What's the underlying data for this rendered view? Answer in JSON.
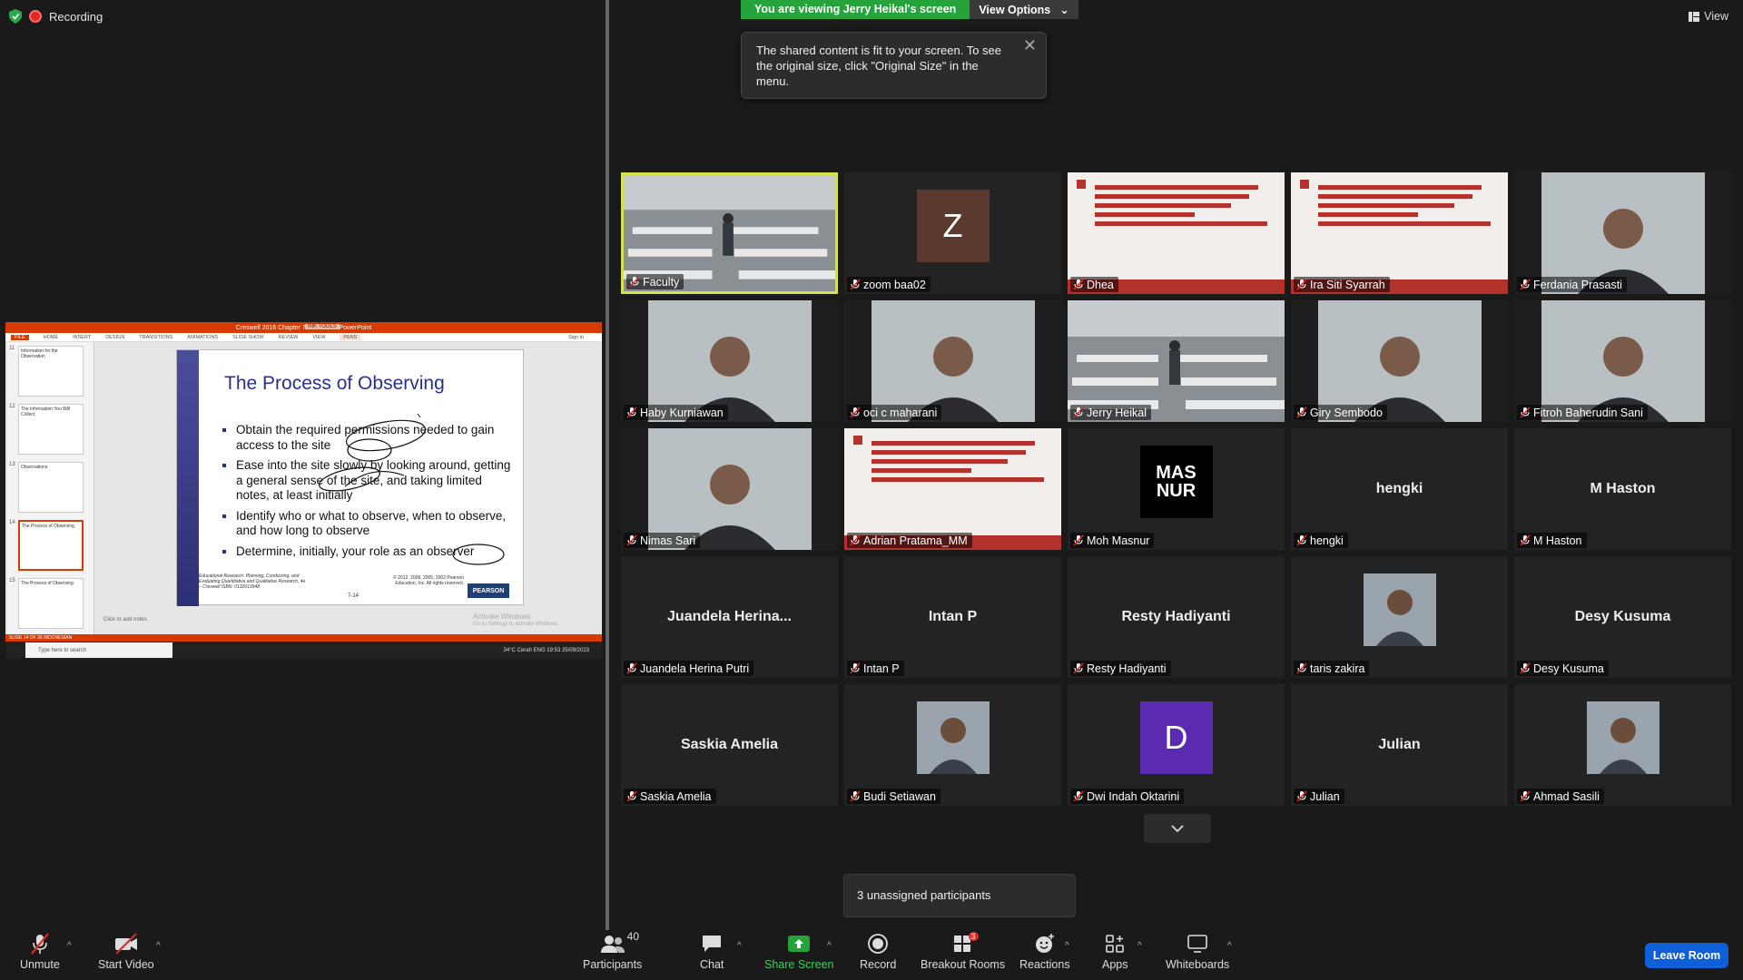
{
  "top": {
    "recording_label": "Recording",
    "banner_text": "You are viewing Jerry Heikal's screen",
    "view_options_label": "View Options",
    "view_label": "View",
    "tip_text": "The shared content is fit to your screen. To see the original size, click \"Original Size\" in the menu."
  },
  "share": {
    "window_title": "Creswell 2016 Chapter 7 - Microsoft PowerPoint",
    "tools_tab": "INK TOOLS",
    "ribbon_tabs": [
      "FILE",
      "HOME",
      "INSERT",
      "DESIGN",
      "TRANSITIONS",
      "ANIMATIONS",
      "SLIDE SHOW",
      "REVIEW",
      "VIEW",
      "PENS"
    ],
    "sign_in": "Sign in",
    "thumbnails": [
      {
        "num": "11",
        "title": "Information for the Observation"
      },
      {
        "num": "12",
        "title": "The Information You Will Collect"
      },
      {
        "num": "13",
        "title": "Observations"
      },
      {
        "num": "14",
        "title": "The Process of Observing"
      },
      {
        "num": "15",
        "title": "The Process of Observing"
      }
    ],
    "slide_title": "The Process of Observing",
    "bullets": [
      "Obtain the required permissions needed to gain access to the site",
      "Ease into the site slowly by looking around, getting a general sense of the site, and taking limited notes, at least initially",
      "Identify who or what to observe, when to observe, and how long to observe",
      "Determine, initially, your role as an observer"
    ],
    "footer_text": "Educational Research: Planning, Conducting, and Evaluating Quantitative and Qualitative Research, 4e – Creswell ISBN: 0132613948",
    "page_number": "7-14",
    "copyright": "© 2012, 2008, 2005, 2002 Pearson Education, Inc. All rights reserved.",
    "pearson_logo": "PEARSON",
    "notes_placeholder": "Click to add notes",
    "activate_title": "Activate Windows",
    "activate_sub": "Go to Settings to activate Windows.",
    "status_text": "SLIDE 14 OF 26    INDONESIAN",
    "taskbar_search": "Type here to search",
    "taskbar_tray": "34°C Cerah   ENG  19:53  25/09/2023"
  },
  "participants": [
    {
      "name": "Faculty",
      "type": "video-room",
      "active": true
    },
    {
      "name": "zoom baa02",
      "type": "avatar",
      "letter": "Z",
      "color": "#5a3a2e"
    },
    {
      "name": "Dhea",
      "type": "video-banner"
    },
    {
      "name": "Ira Siti Syarrah",
      "type": "video-banner-mirror"
    },
    {
      "name": "Ferdania Prasasti",
      "type": "video-person"
    },
    {
      "name": "Haby Kurniawan",
      "type": "video-person"
    },
    {
      "name": "oci c maharani",
      "type": "video-person"
    },
    {
      "name": "Jerry Heikal",
      "type": "video-room"
    },
    {
      "name": "Giry Sembodo",
      "type": "video-person"
    },
    {
      "name": "Fitroh Baherudin Sani",
      "type": "video-person"
    },
    {
      "name": "Nimas Sari",
      "type": "video-person"
    },
    {
      "name": "Adrian Pratama_MM",
      "type": "video-banner"
    },
    {
      "name": "Moh Masnur",
      "type": "logo",
      "logo_text": "MAS NUR"
    },
    {
      "name": "hengki",
      "type": "name",
      "center": "hengki"
    },
    {
      "name": "M Haston",
      "type": "name",
      "center": "M Haston"
    },
    {
      "name": "Juandela Herina Putri",
      "type": "name",
      "center": "Juandela  Herina..."
    },
    {
      "name": "Intan P",
      "type": "name",
      "center": "Intan P"
    },
    {
      "name": "Resty Hadiyanti",
      "type": "name",
      "center": "Resty Hadiyanti"
    },
    {
      "name": "taris zakira",
      "type": "photo"
    },
    {
      "name": "Desy Kusuma",
      "type": "name",
      "center": "Desy Kusuma"
    },
    {
      "name": "Saskia Amelia",
      "type": "name",
      "center": "Saskia Amelia"
    },
    {
      "name": "Budi Setiawan",
      "type": "photo"
    },
    {
      "name": "Dwi Indah Oktarini",
      "type": "avatar",
      "letter": "D",
      "color": "#5a2bb0"
    },
    {
      "name": "Julian",
      "type": "name",
      "center": "Julian"
    },
    {
      "name": "Ahmad Sasili",
      "type": "photo"
    }
  ],
  "unassigned_text": "3 unassigned participants",
  "toolbar": {
    "unmute": "Unmute",
    "start_video": "Start Video",
    "participants": "Participants",
    "participants_count": "40",
    "chat": "Chat",
    "share_screen": "Share Screen",
    "record": "Record",
    "breakout_rooms": "Breakout Rooms",
    "breakout_badge": "3",
    "reactions": "Reactions",
    "apps": "Apps",
    "whiteboards": "Whiteboards",
    "leave_room": "Leave Room"
  },
  "colors": {
    "share_green": "#26a33a",
    "leave_blue": "#0e5fd8",
    "active_border": "#d6e24a",
    "mute_red": "#e02828"
  }
}
